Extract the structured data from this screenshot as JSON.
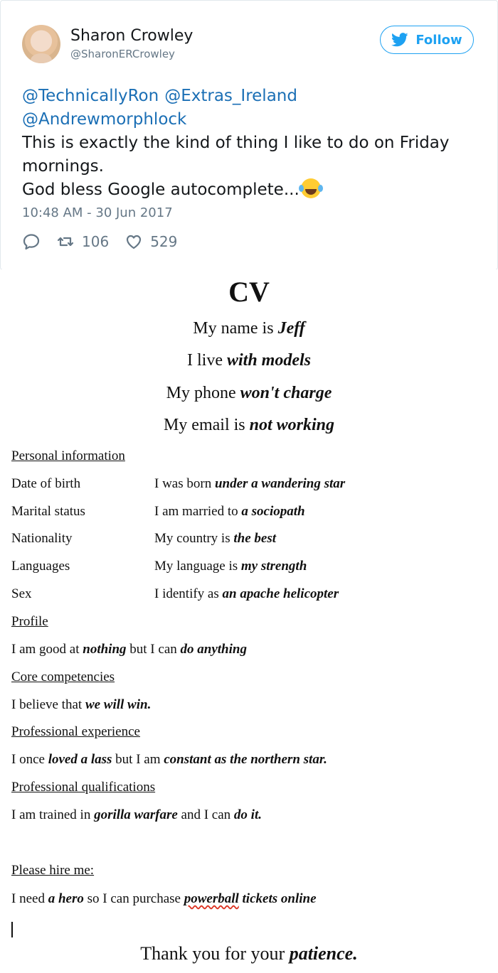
{
  "tweet": {
    "author_name": "Sharon Crowley",
    "author_handle": "@SharonERCrowley",
    "follow_label": "Follow",
    "mentions": [
      "@TechnicallyRon",
      "@Extras_Ireland",
      "@Andrewmorphlock"
    ],
    "body_line1": "This is exactly the kind of thing I like to do on Friday mornings.",
    "body_line2": "God bless Google autocomplete...",
    "emoji": "face-with-tears-of-joy",
    "timestamp": "10:48 AM - 30 Jun 2017",
    "retweets": "106",
    "likes": "529",
    "accent_color": "#1da1f2"
  },
  "cv": {
    "title": "CV",
    "intro": [
      {
        "plain": "My name is ",
        "bold": "Jeff"
      },
      {
        "plain": "I live ",
        "bold": "with models"
      },
      {
        "plain": "My phone ",
        "bold": "won't charge"
      },
      {
        "plain": "My email is ",
        "bold": "not working"
      }
    ],
    "personal_heading": "Personal information",
    "personal_rows": [
      {
        "label": "Date of birth",
        "plain": "I was born ",
        "bold": "under a wandering star"
      },
      {
        "label": "Marital status",
        "plain": "I am married to ",
        "bold": "a sociopath"
      },
      {
        "label": "Nationality",
        "plain": "My country is ",
        "bold": "the best"
      },
      {
        "label": "Languages",
        "plain": "My language is ",
        "bold": "my strength"
      },
      {
        "label": "Sex",
        "plain": "I identify as ",
        "bold": "an apache helicopter"
      }
    ],
    "profile_heading": "Profile",
    "profile_text": {
      "a": "I am good at ",
      "b": "nothing",
      "c": " but I can ",
      "d": "do anything"
    },
    "core_heading": "Core competencies",
    "core_text": {
      "a": "I believe that ",
      "b": "we will win."
    },
    "experience_heading": "Professional experience",
    "experience_text": {
      "a": "I once ",
      "b": "loved a lass",
      "c": " but I am ",
      "d": "constant as the northern star."
    },
    "qualifications_heading": "Professional qualifications",
    "qualifications_text": {
      "a": "I am trained in ",
      "b": "gorilla warfare",
      "c": " and I can ",
      "d": "do it."
    },
    "hire_heading": "Please hire me:",
    "hire_text": {
      "a": "I need ",
      "b": "a hero",
      "c": " so I can purchase ",
      "d": "powerball",
      "e": " tickets online"
    },
    "thanks": {
      "a": "Thank you for your ",
      "b": "patience."
    }
  }
}
